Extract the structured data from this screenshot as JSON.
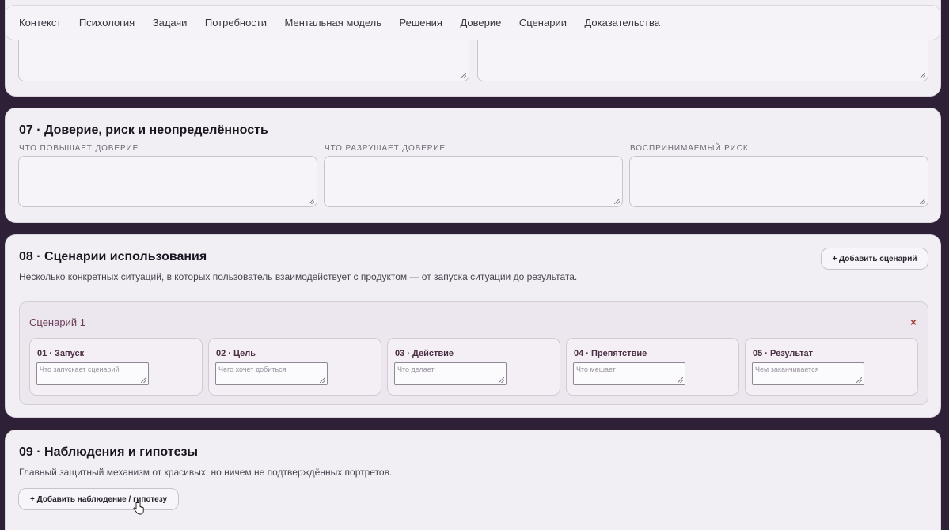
{
  "nav": {
    "items": [
      "Контекст",
      "Психология",
      "Задачи",
      "Потребности",
      "Ментальная модель",
      "Решения",
      "Доверие",
      "Сценарии",
      "Доказательства"
    ]
  },
  "trust": {
    "title": "07 · Доверие, риск и неопределённость",
    "fields": [
      "Что повышает доверие",
      "Что разрушает доверие",
      "Воспринимаемый риск"
    ]
  },
  "scenarios": {
    "title": "08 · Сценарии использования",
    "subtitle": "Несколько конкретных ситуаций, в которых пользователь взаимодействует с продуктом — от запуска ситуации до результата.",
    "add_button": "+ Добавить сценарий",
    "scenario": {
      "title": "Сценарий 1",
      "close": "×",
      "steps": [
        {
          "title": "01 · Запуск",
          "placeholder": "Что запускает сценарий"
        },
        {
          "title": "02 · Цель",
          "placeholder": "Чего хочет добиться"
        },
        {
          "title": "03 · Действие",
          "placeholder": "Что делает"
        },
        {
          "title": "04 · Препятствие",
          "placeholder": "Что мешает"
        },
        {
          "title": "05 · Результат",
          "placeholder": "Чем заканчивается"
        }
      ]
    }
  },
  "observations": {
    "title": "09 · Наблюдения и гипотезы",
    "subtitle": "Главный защитный механизм от красивых, но ничем не подтверждённых портретов.",
    "add_button": "+ Добавить наблюдение / гипотезу"
  },
  "colors": {
    "background": "#2e2036",
    "card": "#f1eff4",
    "accent": "#6b3f5a",
    "close": "#a23d32"
  }
}
